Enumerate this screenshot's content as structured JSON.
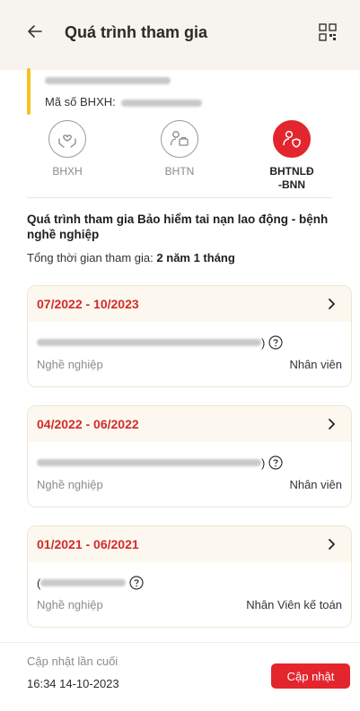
{
  "header": {
    "title": "Quá trình tham gia",
    "back_icon": "arrow-left-icon",
    "qr_icon": "qr-code-icon"
  },
  "profile": {
    "bhxh_label": "Mã số BHXH:",
    "bhxh_prefix": ":"
  },
  "tabs": [
    {
      "label": "BHXH",
      "icon": "hands-heart-icon",
      "active": false
    },
    {
      "label": "BHTN",
      "icon": "user-briefcase-icon",
      "active": false
    },
    {
      "label": "BHTNLĐ\n-BNN",
      "icon": "user-shield-icon",
      "active": true
    }
  ],
  "section": {
    "title": "Quá trình tham gia Bảo hiểm tai nạn lao động - bệnh nghề nghiệp",
    "total_label": "Tổng thời gian tham gia:",
    "total_value": "2 năm 1 tháng"
  },
  "records": [
    {
      "period": "07/2022 - 10/2023",
      "company_suffix": ")",
      "job_label": "Nghề nghiệp",
      "job_value": "Nhân viên"
    },
    {
      "period": "04/2022 - 06/2022",
      "company_suffix": ")",
      "job_label": "Nghề nghiệp",
      "job_value": "Nhân viên"
    },
    {
      "period": "01/2021 - 06/2021",
      "company_prefix": "(",
      "job_label": "Nghề nghiệp",
      "job_value": "Nhân Viên kế toán"
    }
  ],
  "footer": {
    "last_update_label": "Cập nhật lần cuối",
    "last_update_value": "16:34 14-10-2023",
    "update_button": "Cập nhật"
  },
  "colors": {
    "accent": "#e3262d",
    "header_bg": "#f7f3ee",
    "card_head_bg": "#fdf8ef",
    "highlight_bar": "#f4c21d"
  }
}
